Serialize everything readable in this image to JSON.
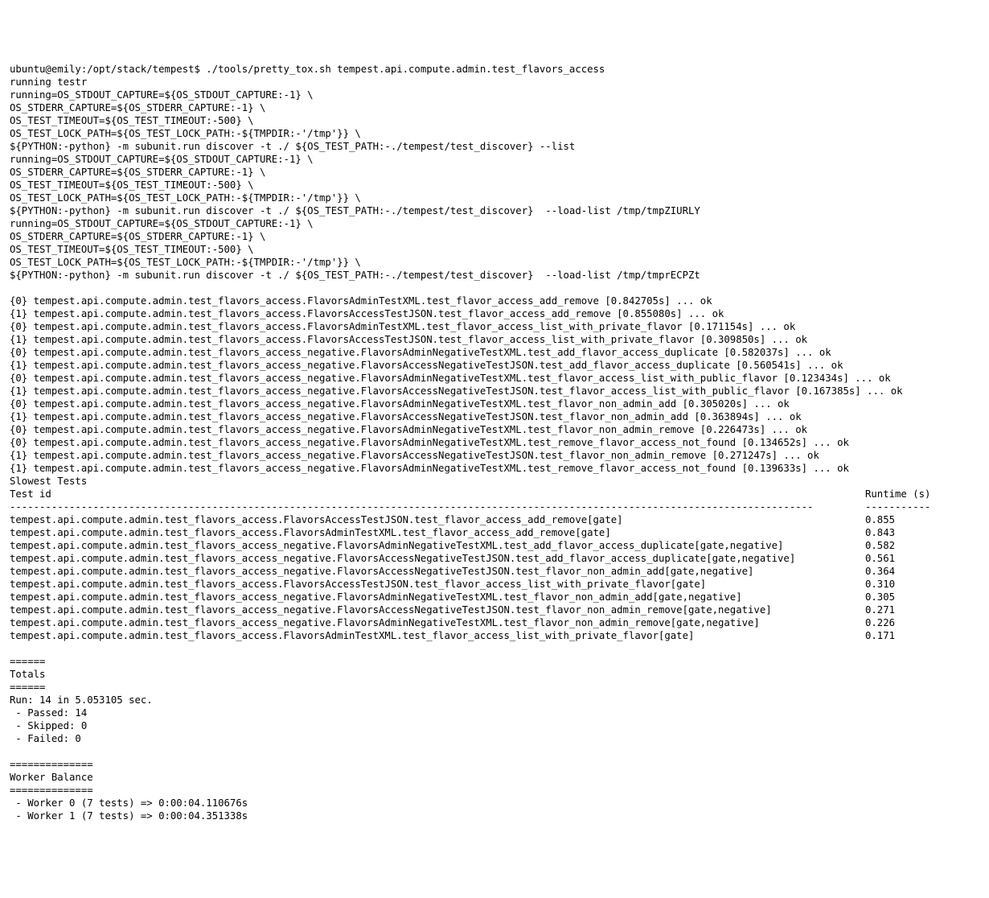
{
  "prompt": "ubuntu@emily:/opt/stack/tempest$ ./tools/pretty_tox.sh tempest.api.compute.admin.test_flavors_access",
  "pre": [
    "running testr",
    "running=OS_STDOUT_CAPTURE=${OS_STDOUT_CAPTURE:-1} \\",
    "OS_STDERR_CAPTURE=${OS_STDERR_CAPTURE:-1} \\",
    "OS_TEST_TIMEOUT=${OS_TEST_TIMEOUT:-500} \\",
    "OS_TEST_LOCK_PATH=${OS_TEST_LOCK_PATH:-${TMPDIR:-'/tmp'}} \\",
    "${PYTHON:-python} -m subunit.run discover -t ./ ${OS_TEST_PATH:-./tempest/test_discover} --list",
    "running=OS_STDOUT_CAPTURE=${OS_STDOUT_CAPTURE:-1} \\",
    "OS_STDERR_CAPTURE=${OS_STDERR_CAPTURE:-1} \\",
    "OS_TEST_TIMEOUT=${OS_TEST_TIMEOUT:-500} \\",
    "OS_TEST_LOCK_PATH=${OS_TEST_LOCK_PATH:-${TMPDIR:-'/tmp'}} \\",
    "${PYTHON:-python} -m subunit.run discover -t ./ ${OS_TEST_PATH:-./tempest/test_discover}  --load-list /tmp/tmpZIURLY",
    "running=OS_STDOUT_CAPTURE=${OS_STDOUT_CAPTURE:-1} \\",
    "OS_STDERR_CAPTURE=${OS_STDERR_CAPTURE:-1} \\",
    "OS_TEST_TIMEOUT=${OS_TEST_TIMEOUT:-500} \\",
    "OS_TEST_LOCK_PATH=${OS_TEST_LOCK_PATH:-${TMPDIR:-'/tmp'}} \\",
    "${PYTHON:-python} -m subunit.run discover -t ./ ${OS_TEST_PATH:-./tempest/test_discover}  --load-list /tmp/tmprECPZt"
  ],
  "results": [
    "{0} tempest.api.compute.admin.test_flavors_access.FlavorsAdminTestXML.test_flavor_access_add_remove [0.842705s] ... ok",
    "{1} tempest.api.compute.admin.test_flavors_access.FlavorsAccessTestJSON.test_flavor_access_add_remove [0.855080s] ... ok",
    "{0} tempest.api.compute.admin.test_flavors_access.FlavorsAdminTestXML.test_flavor_access_list_with_private_flavor [0.171154s] ... ok",
    "{1} tempest.api.compute.admin.test_flavors_access.FlavorsAccessTestJSON.test_flavor_access_list_with_private_flavor [0.309850s] ... ok",
    "{0} tempest.api.compute.admin.test_flavors_access_negative.FlavorsAdminNegativeTestXML.test_add_flavor_access_duplicate [0.582037s] ... ok",
    "{1} tempest.api.compute.admin.test_flavors_access_negative.FlavorsAccessNegativeTestJSON.test_add_flavor_access_duplicate [0.560541s] ... ok",
    "{0} tempest.api.compute.admin.test_flavors_access_negative.FlavorsAdminNegativeTestXML.test_flavor_access_list_with_public_flavor [0.123434s] ... ok",
    "{1} tempest.api.compute.admin.test_flavors_access_negative.FlavorsAccessNegativeTestJSON.test_flavor_access_list_with_public_flavor [0.167385s] ... ok",
    "{0} tempest.api.compute.admin.test_flavors_access_negative.FlavorsAdminNegativeTestXML.test_flavor_non_admin_add [0.305020s] ... ok",
    "{1} tempest.api.compute.admin.test_flavors_access_negative.FlavorsAccessNegativeTestJSON.test_flavor_non_admin_add [0.363894s] ... ok",
    "{0} tempest.api.compute.admin.test_flavors_access_negative.FlavorsAdminNegativeTestXML.test_flavor_non_admin_remove [0.226473s] ... ok",
    "{0} tempest.api.compute.admin.test_flavors_access_negative.FlavorsAdminNegativeTestXML.test_remove_flavor_access_not_found [0.134652s] ... ok",
    "{1} tempest.api.compute.admin.test_flavors_access_negative.FlavorsAccessNegativeTestJSON.test_flavor_non_admin_remove [0.271247s] ... ok",
    "{1} tempest.api.compute.admin.test_flavors_access_negative.FlavorsAdminNegativeTestXML.test_remove_flavor_access_not_found [0.139633s] ... ok"
  ],
  "slowest_title": "Slowest Tests",
  "header": {
    "id": "Test id",
    "runtime": "Runtime (s)"
  },
  "divider_id": "---------------------------------------------------------------------------------------------------------------------------------------",
  "divider_rt": "-----------",
  "chart_data": {
    "type": "table",
    "title": "Slowest Tests",
    "columns": [
      "Test id",
      "Runtime (s)"
    ],
    "rows": [
      {
        "id": "tempest.api.compute.admin.test_flavors_access.FlavorsAccessTestJSON.test_flavor_access_add_remove[gate]",
        "rt": "0.855"
      },
      {
        "id": "tempest.api.compute.admin.test_flavors_access.FlavorsAdminTestXML.test_flavor_access_add_remove[gate]",
        "rt": "0.843"
      },
      {
        "id": "tempest.api.compute.admin.test_flavors_access_negative.FlavorsAdminNegativeTestXML.test_add_flavor_access_duplicate[gate,negative]",
        "rt": "0.582"
      },
      {
        "id": "tempest.api.compute.admin.test_flavors_access_negative.FlavorsAccessNegativeTestJSON.test_add_flavor_access_duplicate[gate,negative]",
        "rt": "0.561"
      },
      {
        "id": "tempest.api.compute.admin.test_flavors_access_negative.FlavorsAccessNegativeTestJSON.test_flavor_non_admin_add[gate,negative]",
        "rt": "0.364"
      },
      {
        "id": "tempest.api.compute.admin.test_flavors_access.FlavorsAccessTestJSON.test_flavor_access_list_with_private_flavor[gate]",
        "rt": "0.310"
      },
      {
        "id": "tempest.api.compute.admin.test_flavors_access_negative.FlavorsAdminNegativeTestXML.test_flavor_non_admin_add[gate,negative]",
        "rt": "0.305"
      },
      {
        "id": "tempest.api.compute.admin.test_flavors_access_negative.FlavorsAccessNegativeTestJSON.test_flavor_non_admin_remove[gate,negative]",
        "rt": "0.271"
      },
      {
        "id": "tempest.api.compute.admin.test_flavors_access_negative.FlavorsAdminNegativeTestXML.test_flavor_non_admin_remove[gate,negative]",
        "rt": "0.226"
      },
      {
        "id": "tempest.api.compute.admin.test_flavors_access.FlavorsAdminTestXML.test_flavor_access_list_with_private_flavor[gate]",
        "rt": "0.171"
      }
    ]
  },
  "totals": {
    "sep": "======",
    "title": "Totals",
    "run": "Run: 14 in 5.053105 sec.",
    "passed": " - Passed: 14",
    "skipped": " - Skipped: 0",
    "failed": " - Failed: 0"
  },
  "worker": {
    "sep": "==============",
    "title": "Worker Balance",
    "lines": [
      " - Worker 0 (7 tests) => 0:00:04.110676s",
      " - Worker 1 (7 tests) => 0:00:04.351338s"
    ]
  }
}
